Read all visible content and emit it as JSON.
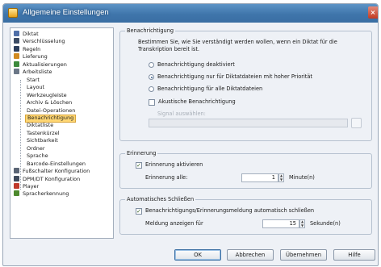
{
  "window": {
    "title": "Allgemeine Einstellungen",
    "close_glyph": "×"
  },
  "tree": {
    "items": [
      {
        "label": "Diktat",
        "icon": "dictation-icon",
        "color": "#4f6fa8"
      },
      {
        "label": "Verschlüsselung",
        "icon": "lock-icon",
        "color": "#3b4b64"
      },
      {
        "label": "Regeln",
        "icon": "rules-icon",
        "color": "#2c3e5c"
      },
      {
        "label": "Lieferung",
        "icon": "delivery-icon",
        "color": "#d18a1f"
      },
      {
        "label": "Aktualisierungen",
        "icon": "update-icon",
        "color": "#3c8a3c"
      },
      {
        "label": "Arbeitsliste",
        "icon": "worklist-icon",
        "color": "#6b7787"
      },
      {
        "label": "Start"
      },
      {
        "label": "Layout"
      },
      {
        "label": "Werkzeugleiste"
      },
      {
        "label": "Archiv & Löschen"
      },
      {
        "label": "Datei-Operationen"
      },
      {
        "label": "Benachrichtigung",
        "selected": true
      },
      {
        "label": "Diktatliste"
      },
      {
        "label": "Tastenkürzel"
      },
      {
        "label": "Sichtbarkeit"
      },
      {
        "label": "Ordner"
      },
      {
        "label": "Sprache"
      },
      {
        "label": "Barcode-Einstellungen"
      },
      {
        "label": "Fußschalter Konfiguration",
        "icon": "footswitch-icon",
        "color": "#5a6474"
      },
      {
        "label": "DPM/DT Konfiguration",
        "icon": "device-icon",
        "color": "#3f4a5c"
      },
      {
        "label": "Player",
        "icon": "player-icon",
        "color": "#c0392b"
      },
      {
        "label": "Spracherkennung",
        "icon": "speech-icon",
        "color": "#4d8a2e"
      }
    ]
  },
  "notification": {
    "title": "Benachrichtigung",
    "intro_line1": "Bestimmen Sie, wie Sie verständigt werden wollen, wenn ein Diktat für die",
    "intro_line2": "Transkription bereit ist.",
    "options": [
      {
        "label": "Benachrichtigung deaktiviert",
        "selected": false
      },
      {
        "label": "Benachrichtigung nur für Diktatdateien mit hoher Priorität",
        "selected": true
      },
      {
        "label": "Benachrichtigung für alle Diktatdateien",
        "selected": false
      }
    ],
    "acoustic_label": "Akustische Benachrichtigung",
    "acoustic_checked": false,
    "signal_label": "Signal auswählen:",
    "signal_value": ""
  },
  "reminder": {
    "title": "Erinnerung",
    "enable_label": "Erinnerung aktivieren",
    "enable_checked": true,
    "every_label": "Erinnerung alle:",
    "every_value": "1",
    "every_unit": "Minute(n)"
  },
  "autoclose": {
    "title": "Automatisches Schließen",
    "enable_label": "Benachrichtigungs/Erinnerungsmeldung automatisch schließen",
    "enable_checked": true,
    "show_label": "Meldung anzeigen für",
    "show_value": "15",
    "show_unit": "Sekunde(n)"
  },
  "buttons": {
    "ok": "OK",
    "cancel": "Abbrechen",
    "apply": "Übernehmen",
    "help": "Hilfe"
  }
}
